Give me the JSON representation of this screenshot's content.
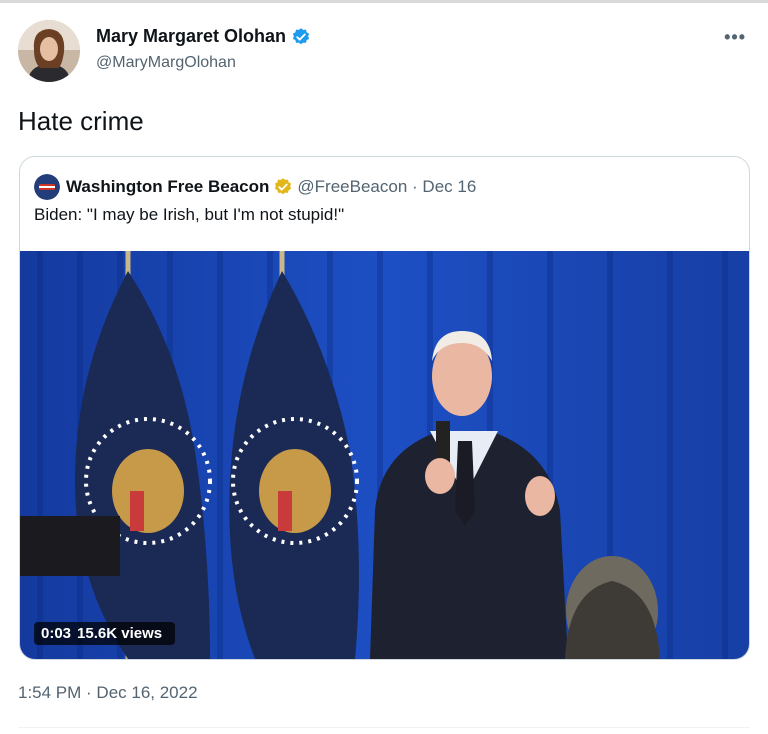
{
  "author": {
    "display_name": "Mary Margaret Olohan",
    "handle": "@MaryMargOlohan",
    "verified_icon": "verified-badge-icon",
    "more_icon": "ellipsis-icon"
  },
  "tweet": {
    "text": "Hate crime",
    "timestamp": "1:54 PM · Dec 16, 2022"
  },
  "quoted": {
    "display_name": "Washington Free Beacon",
    "handle": "@FreeBeacon",
    "separator": "·",
    "date": "Dec 16",
    "text": "Biden: \"I may be Irish, but I'm not stupid!\"",
    "verified_color": "#e2b719"
  },
  "video": {
    "duration": "0:03",
    "views": "15.6K views"
  },
  "colors": {
    "verified_blue": "#1d9bf0",
    "secondary_text": "#536471",
    "curtain_blue": "#1a3fa8"
  }
}
